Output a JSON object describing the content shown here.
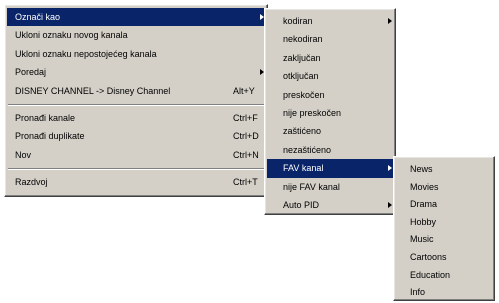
{
  "main_menu": {
    "items": [
      {
        "label": "Označi kao",
        "shortcut": "",
        "submenu": true
      },
      {
        "label": "Ukloni oznaku novog kanala",
        "shortcut": ""
      },
      {
        "label": "Ukloni oznaku nepostojećeg kanala",
        "shortcut": ""
      },
      {
        "label": "Poredaj",
        "shortcut": "",
        "submenu": true
      },
      {
        "label": "DISNEY CHANNEL -> Disney Channel",
        "shortcut": "Alt+Y"
      },
      {
        "label": "Pronađi kanale",
        "shortcut": "Ctrl+F"
      },
      {
        "label": "Pronađi duplikate",
        "shortcut": "Ctrl+D"
      },
      {
        "label": "Nov",
        "shortcut": "Ctrl+N"
      },
      {
        "label": "Razdvoj",
        "shortcut": "Ctrl+T"
      }
    ]
  },
  "mark_as_menu": {
    "items": [
      {
        "label": "kodiran",
        "submenu": true
      },
      {
        "label": "nekodiran"
      },
      {
        "label": "zaključan"
      },
      {
        "label": "otključan"
      },
      {
        "label": "preskočen"
      },
      {
        "label": "nije preskočen"
      },
      {
        "label": "zaštićeno"
      },
      {
        "label": "nezaštićeno"
      },
      {
        "label": "FAV kanal",
        "submenu": true
      },
      {
        "label": "nije FAV kanal"
      },
      {
        "label": "Auto PID",
        "submenu": true
      }
    ]
  },
  "fav_menu": {
    "items": [
      {
        "label": "News"
      },
      {
        "label": "Movies"
      },
      {
        "label": "Drama"
      },
      {
        "label": "Hobby"
      },
      {
        "label": "Music"
      },
      {
        "label": "Cartoons"
      },
      {
        "label": "Education"
      },
      {
        "label": "Info"
      }
    ]
  },
  "colors": {
    "menu_background": "#d4d0c8",
    "highlight": "#0a246a",
    "highlight_text": "#ffffff"
  }
}
